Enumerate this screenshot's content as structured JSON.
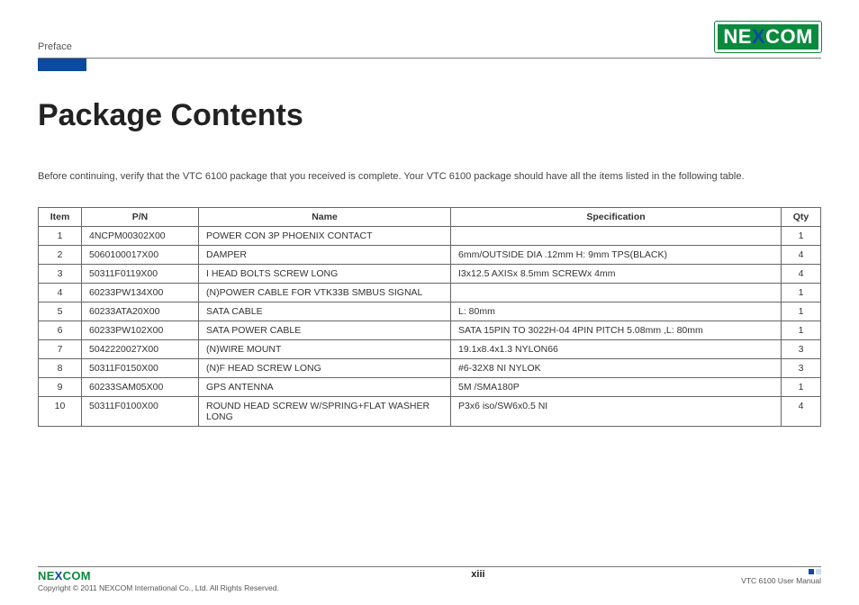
{
  "header": {
    "section": "Preface",
    "brand_segments": [
      "NE",
      "X",
      "COM"
    ]
  },
  "title": "Package Contents",
  "intro": "Before continuing, verify that the VTC 6100 package that you received is complete. Your VTC 6100 package should have all the items listed in the following table.",
  "table": {
    "headers": {
      "item": "Item",
      "pn": "P/N",
      "name": "Name",
      "spec": "Specification",
      "qty": "Qty"
    },
    "rows": [
      {
        "item": "1",
        "pn": "4NCPM00302X00",
        "name": "POWER CON 3P PHOENIX CONTACT",
        "spec": "",
        "qty": "1"
      },
      {
        "item": "2",
        "pn": "5060100017X00",
        "name": "DAMPER",
        "spec": "6mm/OUTSIDE DIA .12mm H: 9mm TPS(BLACK)",
        "qty": "4"
      },
      {
        "item": "3",
        "pn": "50311F0119X00",
        "name": "I HEAD BOLTS SCREW LONG",
        "spec": "I3x12.5 AXISx 8.5mm SCREWx 4mm",
        "qty": "4"
      },
      {
        "item": "4",
        "pn": "60233PW134X00",
        "name": "(N)POWER CABLE FOR VTK33B SMBUS SIGNAL",
        "spec": "",
        "qty": "1"
      },
      {
        "item": "5",
        "pn": "60233ATA20X00",
        "name": "SATA CABLE",
        "spec": "L: 80mm",
        "qty": "1"
      },
      {
        "item": "6",
        "pn": "60233PW102X00",
        "name": "SATA POWER CABLE",
        "spec": "SATA 15PIN TO 3022H-04 4PIN PITCH 5.08mm ,L: 80mm",
        "qty": "1"
      },
      {
        "item": "7",
        "pn": "5042220027X00",
        "name": "(N)WIRE MOUNT",
        "spec": "19.1x8.4x1.3 NYLON66",
        "qty": "3"
      },
      {
        "item": "8",
        "pn": "50311F0150X00",
        "name": "(N)F HEAD SCREW LONG",
        "spec": "#6-32X8 NI NYLOK",
        "qty": "3"
      },
      {
        "item": "9",
        "pn": "60233SAM05X00",
        "name": "GPS ANTENNA",
        "spec": "5M /SMA180P",
        "qty": "1"
      },
      {
        "item": "10",
        "pn": "50311F0100X00",
        "name": "ROUND HEAD SCREW W/SPRING+FLAT WASHER LONG",
        "spec": "P3x6 iso/SW6x0.5 NI",
        "qty": "4"
      }
    ]
  },
  "footer": {
    "brand_segments": [
      "NE",
      "X",
      "COM"
    ],
    "copyright": "Copyright © 2011 NEXCOM International Co., Ltd. All Rights Reserved.",
    "page": "xiii",
    "manual": "VTC 6100 User Manual"
  }
}
